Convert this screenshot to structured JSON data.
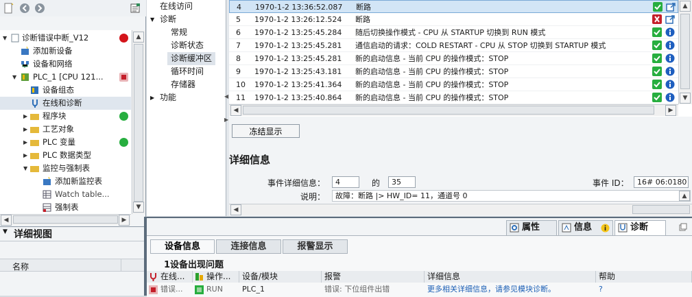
{
  "tree": {
    "project": "诊断错误中断_V12",
    "items": [
      {
        "label": "添加新设备"
      },
      {
        "label": "设备和网络"
      },
      {
        "label": "PLC_1 [CPU 121..."
      },
      {
        "label": "设备组态"
      },
      {
        "label": "在线和诊断"
      },
      {
        "label": "程序块"
      },
      {
        "label": "工艺对象"
      },
      {
        "label": "PLC 变量"
      },
      {
        "label": "PLC 数据类型"
      },
      {
        "label": "监控与强制表"
      },
      {
        "label": "添加新监控表"
      },
      {
        "label": "Watch table..."
      },
      {
        "label": "强制表"
      }
    ]
  },
  "detail_view": {
    "title": "详细视图",
    "col_name": "名称"
  },
  "nav": {
    "online_access": "在线访问",
    "diagnostics": "诊断",
    "general": "常规",
    "diag_status": "诊断状态",
    "diag_buffer": "诊断缓冲区",
    "cycle_time": "循环时间",
    "memory": "存储器",
    "functions": "功能"
  },
  "buffer": {
    "rows": [
      {
        "no": "4",
        "time": "1970-1-2 13:36:52.087",
        "text": "断路"
      },
      {
        "no": "5",
        "time": "1970-1-2 13:26:12.524",
        "text": "断路"
      },
      {
        "no": "6",
        "time": "1970-1-2 13:25:45.284",
        "text": "随后切换操作模式 - CPU 从 STARTUP 切换到 RUN 模式"
      },
      {
        "no": "7",
        "time": "1970-1-2 13:25:45.281",
        "text": "通信启动的请求：COLD RESTART - CPU 从 STOP 切换到 STARTUP 模式"
      },
      {
        "no": "8",
        "time": "1970-1-2 13:25:45.281",
        "text": "新的启动信息 - 当前 CPU 的操作模式：STOP"
      },
      {
        "no": "9",
        "time": "1970-1-2 13:25:43.181",
        "text": "新的启动信息 - 当前 CPU 的操作模式：STOP"
      },
      {
        "no": "10",
        "time": "1970-1-2 13:25:41.364",
        "text": "新的启动信息 - 当前 CPU 的操作模式：STOP"
      },
      {
        "no": "11",
        "time": "1970-1-2 13:25:40.864",
        "text": "新的启动信息 - 当前 CPU 的操作模式：STOP"
      }
    ],
    "freeze_button": "冻结显示"
  },
  "details": {
    "title": "详细信息",
    "event_detail_label": "事件详细信息：",
    "event_index": "4",
    "of_label": "的",
    "event_total": "35",
    "event_id_label": "事件 ID：",
    "event_id": "16# 06:0180",
    "desc_label": "说明：",
    "desc_text": "故障：断路  |> HW_ID=  11，通道号   0"
  },
  "inspector": {
    "tab_properties": "属性",
    "tab_info": "信息",
    "tab_diagnostics": "诊断",
    "sub_device_info": "设备信息",
    "sub_connection_info": "连接信息",
    "sub_alarm_display": "报警显示",
    "summary": "1设备出现问题",
    "headers": {
      "online": "在线...",
      "operating": "操作...",
      "device": "设备/模块",
      "alarm": "报警",
      "detail": "详细信息",
      "help": "帮助"
    },
    "row": {
      "online": "错误...",
      "operating": "RUN",
      "device": "PLC_1",
      "alarm": "错误: 下位组件出错",
      "detail": "更多相关详细信息，请参见模块诊断。",
      "help": "?"
    }
  }
}
